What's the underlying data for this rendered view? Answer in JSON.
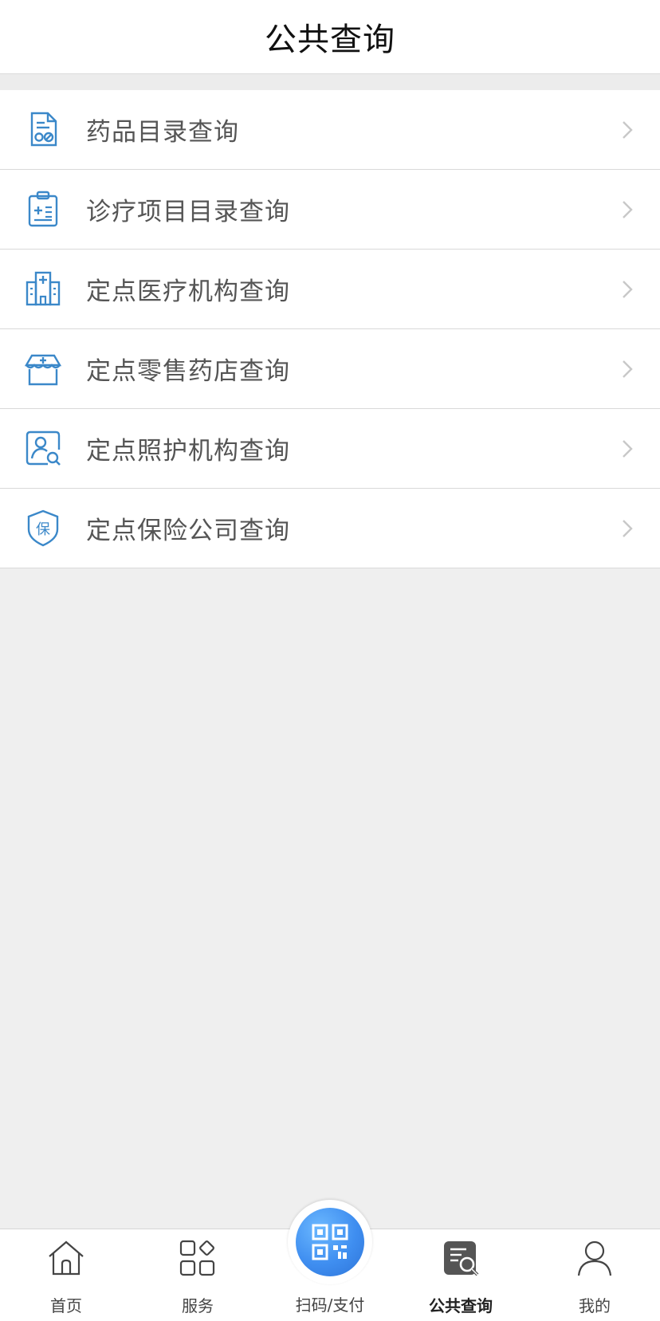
{
  "header": {
    "title": "公共查询"
  },
  "menu": {
    "items": [
      {
        "label": "药品目录查询",
        "icon": "medicine-list-icon"
      },
      {
        "label": "诊疗项目目录查询",
        "icon": "clipboard-medical-icon"
      },
      {
        "label": "定点医疗机构查询",
        "icon": "hospital-building-icon"
      },
      {
        "label": "定点零售药店查询",
        "icon": "pharmacy-store-icon"
      },
      {
        "label": "定点照护机构查询",
        "icon": "person-search-icon"
      },
      {
        "label": "定点保险公司查询",
        "icon": "insurance-shield-icon"
      }
    ]
  },
  "tabbar": {
    "home": "首页",
    "services": "服务",
    "scan": "扫码/支付",
    "public_query": "公共查询",
    "mine": "我的",
    "active": "public_query"
  },
  "colors": {
    "icon_blue": "#3b88c9",
    "scan_blue": "#3f8ef0",
    "chevron": "#c8c8c8"
  }
}
